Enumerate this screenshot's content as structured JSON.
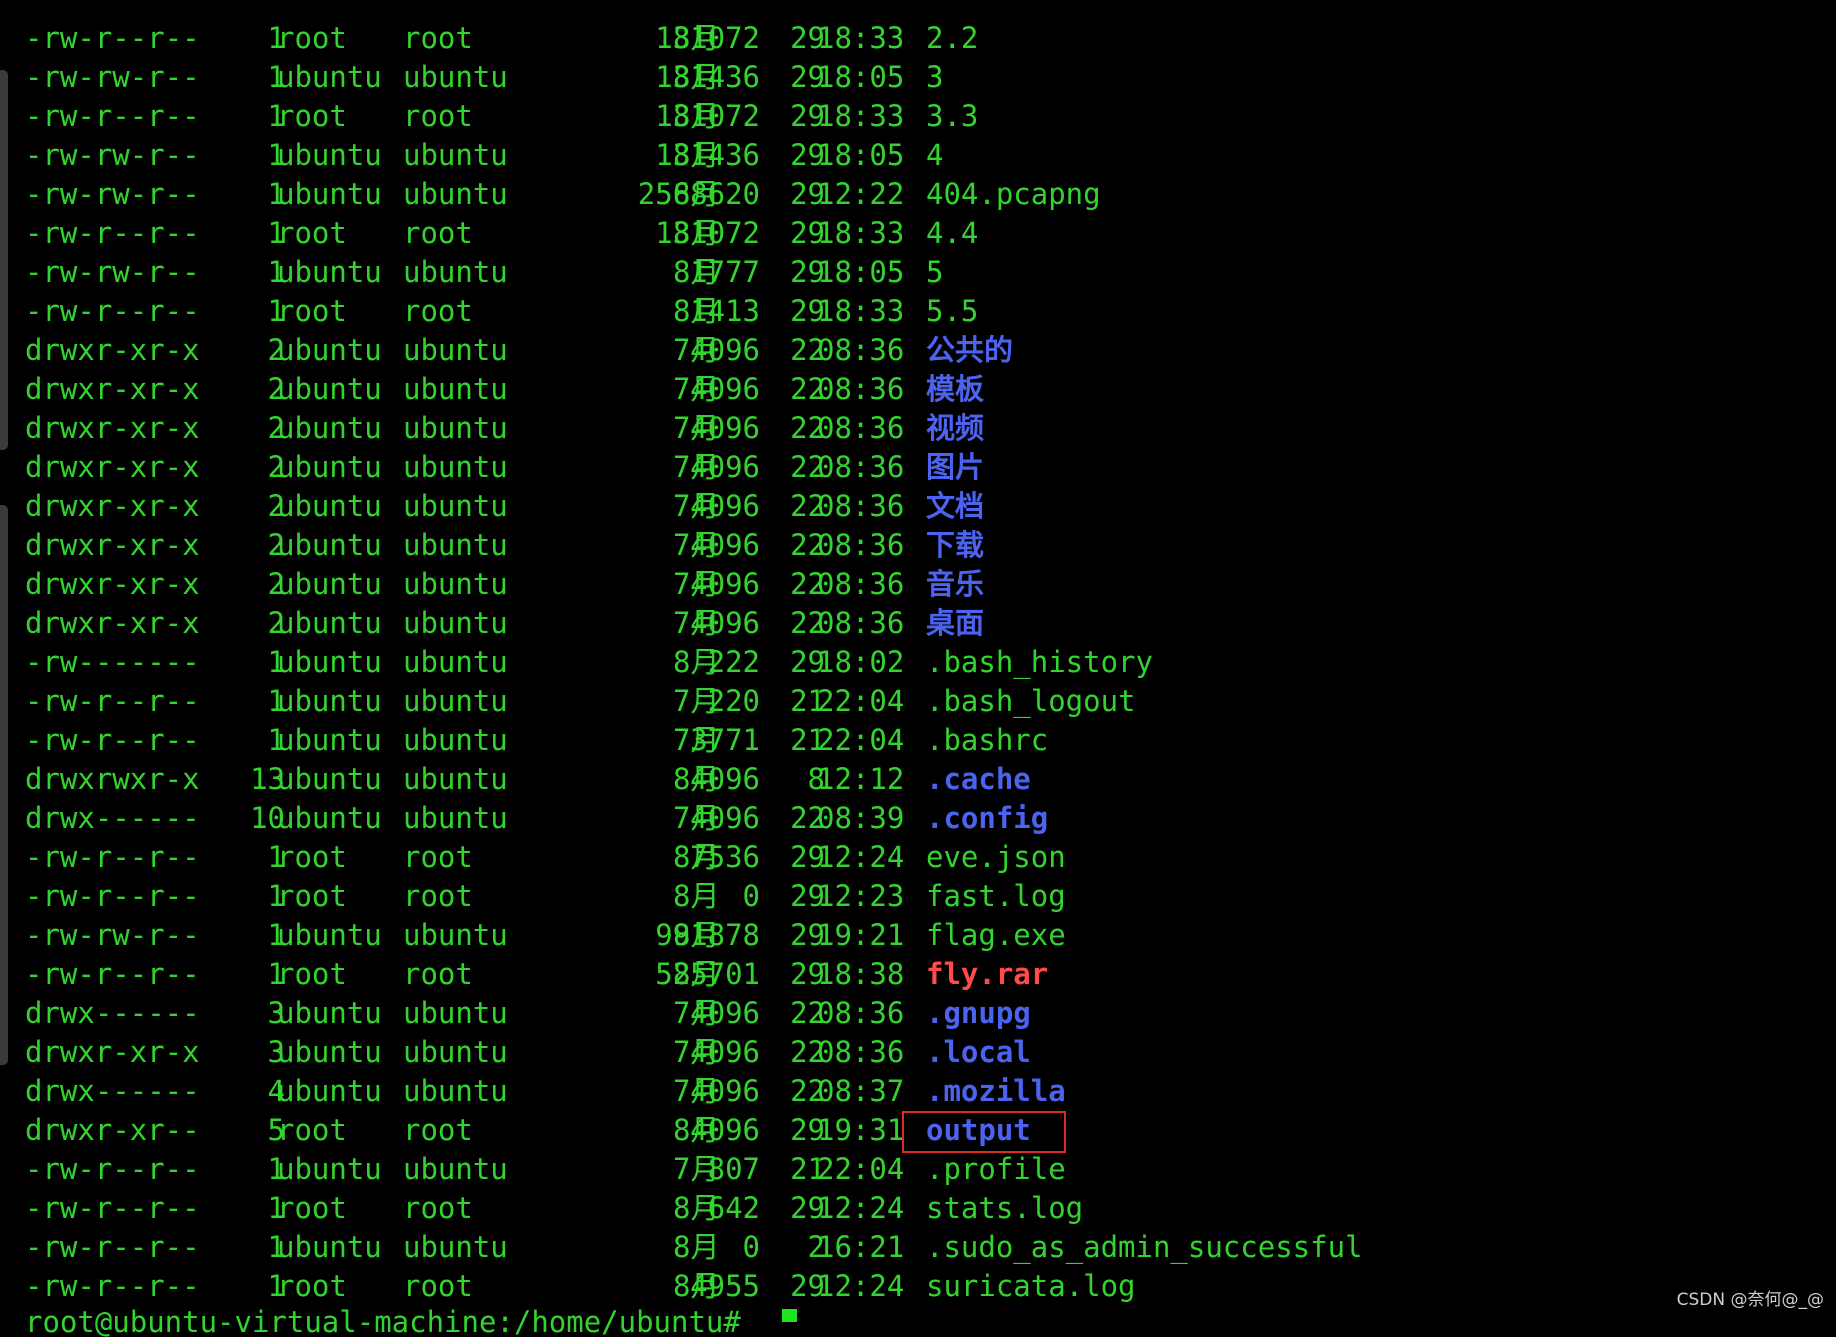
{
  "terminal": {
    "colors": {
      "background": "#000000",
      "text": "#33d42f",
      "directory": "#4c63f0",
      "archive": "#ff4b4b",
      "highlight_border": "#e0292b"
    },
    "rows": [
      {
        "perm": "-rw-r--r--",
        "links": "1",
        "owner": "root",
        "group": "root",
        "size": "131072",
        "month": "8月",
        "day": "29",
        "time": "18:33",
        "name": "2.2",
        "kind": "file"
      },
      {
        "perm": "-rw-rw-r--",
        "links": "1",
        "owner": "ubuntu",
        "group": "ubuntu",
        "size": "131436",
        "month": "8月",
        "day": "29",
        "time": "18:05",
        "name": "3",
        "kind": "file"
      },
      {
        "perm": "-rw-r--r--",
        "links": "1",
        "owner": "root",
        "group": "root",
        "size": "131072",
        "month": "8月",
        "day": "29",
        "time": "18:33",
        "name": "3.3",
        "kind": "file"
      },
      {
        "perm": "-rw-rw-r--",
        "links": "1",
        "owner": "ubuntu",
        "group": "ubuntu",
        "size": "131436",
        "month": "8月",
        "day": "29",
        "time": "18:05",
        "name": "4",
        "kind": "file"
      },
      {
        "perm": "-rw-rw-r--",
        "links": "1",
        "owner": "ubuntu",
        "group": "ubuntu",
        "size": "2568620",
        "month": "8月",
        "day": "29",
        "time": "12:22",
        "name": "404.pcapng",
        "kind": "file"
      },
      {
        "perm": "-rw-r--r--",
        "links": "1",
        "owner": "root",
        "group": "root",
        "size": "131072",
        "month": "8月",
        "day": "29",
        "time": "18:33",
        "name": "4.4",
        "kind": "file"
      },
      {
        "perm": "-rw-rw-r--",
        "links": "1",
        "owner": "ubuntu",
        "group": "ubuntu",
        "size": "1777",
        "month": "8月",
        "day": "29",
        "time": "18:05",
        "name": "5",
        "kind": "file"
      },
      {
        "perm": "-rw-r--r--",
        "links": "1",
        "owner": "root",
        "group": "root",
        "size": "1413",
        "month": "8月",
        "day": "29",
        "time": "18:33",
        "name": "5.5",
        "kind": "file"
      },
      {
        "perm": "drwxr-xr-x",
        "links": "2",
        "owner": "ubuntu",
        "group": "ubuntu",
        "size": "4096",
        "month": "7月",
        "day": "22",
        "time": "08:36",
        "name": "公共的",
        "kind": "dir"
      },
      {
        "perm": "drwxr-xr-x",
        "links": "2",
        "owner": "ubuntu",
        "group": "ubuntu",
        "size": "4096",
        "month": "7月",
        "day": "22",
        "time": "08:36",
        "name": "模板",
        "kind": "dir"
      },
      {
        "perm": "drwxr-xr-x",
        "links": "2",
        "owner": "ubuntu",
        "group": "ubuntu",
        "size": "4096",
        "month": "7月",
        "day": "22",
        "time": "08:36",
        "name": "视频",
        "kind": "dir"
      },
      {
        "perm": "drwxr-xr-x",
        "links": "2",
        "owner": "ubuntu",
        "group": "ubuntu",
        "size": "4096",
        "month": "7月",
        "day": "22",
        "time": "08:36",
        "name": "图片",
        "kind": "dir"
      },
      {
        "perm": "drwxr-xr-x",
        "links": "2",
        "owner": "ubuntu",
        "group": "ubuntu",
        "size": "4096",
        "month": "7月",
        "day": "22",
        "time": "08:36",
        "name": "文档",
        "kind": "dir"
      },
      {
        "perm": "drwxr-xr-x",
        "links": "2",
        "owner": "ubuntu",
        "group": "ubuntu",
        "size": "4096",
        "month": "7月",
        "day": "22",
        "time": "08:36",
        "name": "下载",
        "kind": "dir"
      },
      {
        "perm": "drwxr-xr-x",
        "links": "2",
        "owner": "ubuntu",
        "group": "ubuntu",
        "size": "4096",
        "month": "7月",
        "day": "22",
        "time": "08:36",
        "name": "音乐",
        "kind": "dir"
      },
      {
        "perm": "drwxr-xr-x",
        "links": "2",
        "owner": "ubuntu",
        "group": "ubuntu",
        "size": "4096",
        "month": "7月",
        "day": "22",
        "time": "08:36",
        "name": "桌面",
        "kind": "dir"
      },
      {
        "perm": "-rw-------",
        "links": "1",
        "owner": "ubuntu",
        "group": "ubuntu",
        "size": "222",
        "month": "8月",
        "day": "29",
        "time": "18:02",
        "name": ".bash_history",
        "kind": "file"
      },
      {
        "perm": "-rw-r--r--",
        "links": "1",
        "owner": "ubuntu",
        "group": "ubuntu",
        "size": "220",
        "month": "7月",
        "day": "21",
        "time": "22:04",
        "name": ".bash_logout",
        "kind": "file"
      },
      {
        "perm": "-rw-r--r--",
        "links": "1",
        "owner": "ubuntu",
        "group": "ubuntu",
        "size": "3771",
        "month": "7月",
        "day": "21",
        "time": "22:04",
        "name": ".bashrc",
        "kind": "file"
      },
      {
        "perm": "drwxrwxr-x",
        "links": "13",
        "owner": "ubuntu",
        "group": "ubuntu",
        "size": "4096",
        "month": "8月",
        "day": "8",
        "time": "12:12",
        "name": ".cache",
        "kind": "dir"
      },
      {
        "perm": "drwx------",
        "links": "10",
        "owner": "ubuntu",
        "group": "ubuntu",
        "size": "4096",
        "month": "7月",
        "day": "22",
        "time": "08:39",
        "name": ".config",
        "kind": "dir"
      },
      {
        "perm": "-rw-r--r--",
        "links": "1",
        "owner": "root",
        "group": "root",
        "size": "7536",
        "month": "8月",
        "day": "29",
        "time": "12:24",
        "name": "eve.json",
        "kind": "file"
      },
      {
        "perm": "-rw-r--r--",
        "links": "1",
        "owner": "root",
        "group": "root",
        "size": "0",
        "month": "8月",
        "day": "29",
        "time": "12:23",
        "name": "fast.log",
        "kind": "file"
      },
      {
        "perm": "-rw-rw-r--",
        "links": "1",
        "owner": "ubuntu",
        "group": "ubuntu",
        "size": "991878",
        "month": "8月",
        "day": "29",
        "time": "19:21",
        "name": "flag.exe",
        "kind": "file"
      },
      {
        "perm": "-rw-r--r--",
        "links": "1",
        "owner": "root",
        "group": "root",
        "size": "525701",
        "month": "8月",
        "day": "29",
        "time": "18:38",
        "name": "fly.rar",
        "kind": "archive"
      },
      {
        "perm": "drwx------",
        "links": "3",
        "owner": "ubuntu",
        "group": "ubuntu",
        "size": "4096",
        "month": "7月",
        "day": "22",
        "time": "08:36",
        "name": ".gnupg",
        "kind": "dir"
      },
      {
        "perm": "drwxr-xr-x",
        "links": "3",
        "owner": "ubuntu",
        "group": "ubuntu",
        "size": "4096",
        "month": "7月",
        "day": "22",
        "time": "08:36",
        "name": ".local",
        "kind": "dir"
      },
      {
        "perm": "drwx------",
        "links": "4",
        "owner": "ubuntu",
        "group": "ubuntu",
        "size": "4096",
        "month": "7月",
        "day": "22",
        "time": "08:37",
        "name": ".mozilla",
        "kind": "dir"
      },
      {
        "perm": "drwxr-xr--",
        "links": "5",
        "owner": "root",
        "group": "root",
        "size": "4096",
        "month": "8月",
        "day": "29",
        "time": "19:31",
        "name": "output",
        "kind": "dir"
      },
      {
        "perm": "-rw-r--r--",
        "links": "1",
        "owner": "ubuntu",
        "group": "ubuntu",
        "size": "807",
        "month": "7月",
        "day": "21",
        "time": "22:04",
        "name": ".profile",
        "kind": "file"
      },
      {
        "perm": "-rw-r--r--",
        "links": "1",
        "owner": "root",
        "group": "root",
        "size": "642",
        "month": "8月",
        "day": "29",
        "time": "12:24",
        "name": "stats.log",
        "kind": "file"
      },
      {
        "perm": "-rw-r--r--",
        "links": "1",
        "owner": "ubuntu",
        "group": "ubuntu",
        "size": "0",
        "month": "8月",
        "day": "2",
        "time": "16:21",
        "name": ".sudo_as_admin_successful",
        "kind": "file"
      },
      {
        "perm": "-rw-r--r--",
        "links": "1",
        "owner": "root",
        "group": "root",
        "size": "4955",
        "month": "8月",
        "day": "29",
        "time": "12:24",
        "name": "suricata.log",
        "kind": "file"
      }
    ],
    "prompt_partial": "root@ubuntu-virtual-machine:/home/ubuntu#"
  },
  "watermark": "CSDN @奈何@_@"
}
